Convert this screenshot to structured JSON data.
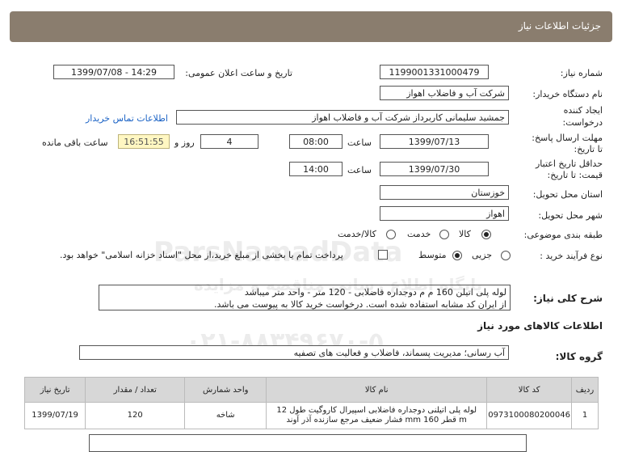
{
  "title": "جزئیات اطلاعات نیاز",
  "fields": {
    "need_number_label": "شماره نیاز:",
    "need_number": "1199001331000479",
    "announce_label": "تاریخ و ساعت اعلان عمومی:",
    "announce_value": "1399/07/08 - 14:29",
    "buyer_label": "نام دستگاه خریدار:",
    "buyer_value": "شرکت آب و فاضلاب اهواز",
    "creator_label_1": "ایجاد کننده",
    "creator_label_2": "درخواست:",
    "creator_value": "جمشید سلیمانی کاربرداز شرکت آب و فاضلاب اهواز",
    "contact_link": "اطلاعات تماس خریدار",
    "deadline_label_1": "مهلت ارسال پاسخ:",
    "deadline_label_2": "تا تاریخ:",
    "deadline_date": "1399/07/13",
    "time_label": "ساعت",
    "deadline_time": "08:00",
    "days_value": "4",
    "days_label": "روز و",
    "remaining_time": "16:51:55",
    "remaining_label": "ساعت باقی مانده",
    "validity_label_1": "حداقل تاریخ اعتبار",
    "validity_label_2": "قیمت: تا تاریخ:",
    "validity_date": "1399/07/30",
    "validity_time": "14:00",
    "province_label": "استان محل تحویل:",
    "province_value": "خوزستان",
    "city_label": "شهر محل تحویل:",
    "city_value": "اهواز",
    "category_label": "طبقه بندی موضوعی:",
    "category_options": [
      "کالا",
      "خدمت",
      "کالا/خدمت"
    ],
    "purchase_label": "نوع فرآیند خرید :",
    "purchase_options": [
      "جزیی",
      "متوسط"
    ],
    "payment_text": "پرداخت تمام یا بخشی از مبلغ خرید،از محل \"اسناد خزانه اسلامی\" خواهد بود."
  },
  "description": {
    "label": "شرح کلی نیاز:",
    "line1": "لوله پلی اتیلن 160 م م دوجداره فاضلابی - 120 متر - واحد متر میباشد",
    "line2": "از ایران کد مشابه استفاده شده است. درخواست خرید کالا به پیوست می باشد."
  },
  "goods_section_title": "اطلاعات کالاهای مورد نیاز",
  "goods_group_label": "گروه کالا:",
  "goods_group_value": "آب رسانی؛ مدیریت پسماند، فاضلاب و فعالیت های تصفیه",
  "table": {
    "headers": [
      "ردیف",
      "کد کالا",
      "نام کالا",
      "واحد شمارش",
      "تعداد / مقدار",
      "تاریخ نیاز"
    ],
    "rows": [
      {
        "index": "1",
        "code": "0973100080200046",
        "name_line1": "لوله پلی اتیلنی دوجداره فاضلابی اسپیرال کاروگیت طول 12",
        "name_line2": "m قطر mm 160 فشار ضعیف مرجع سازنده آذر آوند",
        "unit": "شاخه",
        "qty": "120",
        "date": "1399/07/19"
      }
    ]
  },
  "watermark": {
    "line1": "ParsNamadData",
    "line2": "پایگاه اطلاع رسانی مناقصه و مزایده",
    "line3": "۰۲۱-۸۸۳۴۹۶۷۰-۵"
  }
}
